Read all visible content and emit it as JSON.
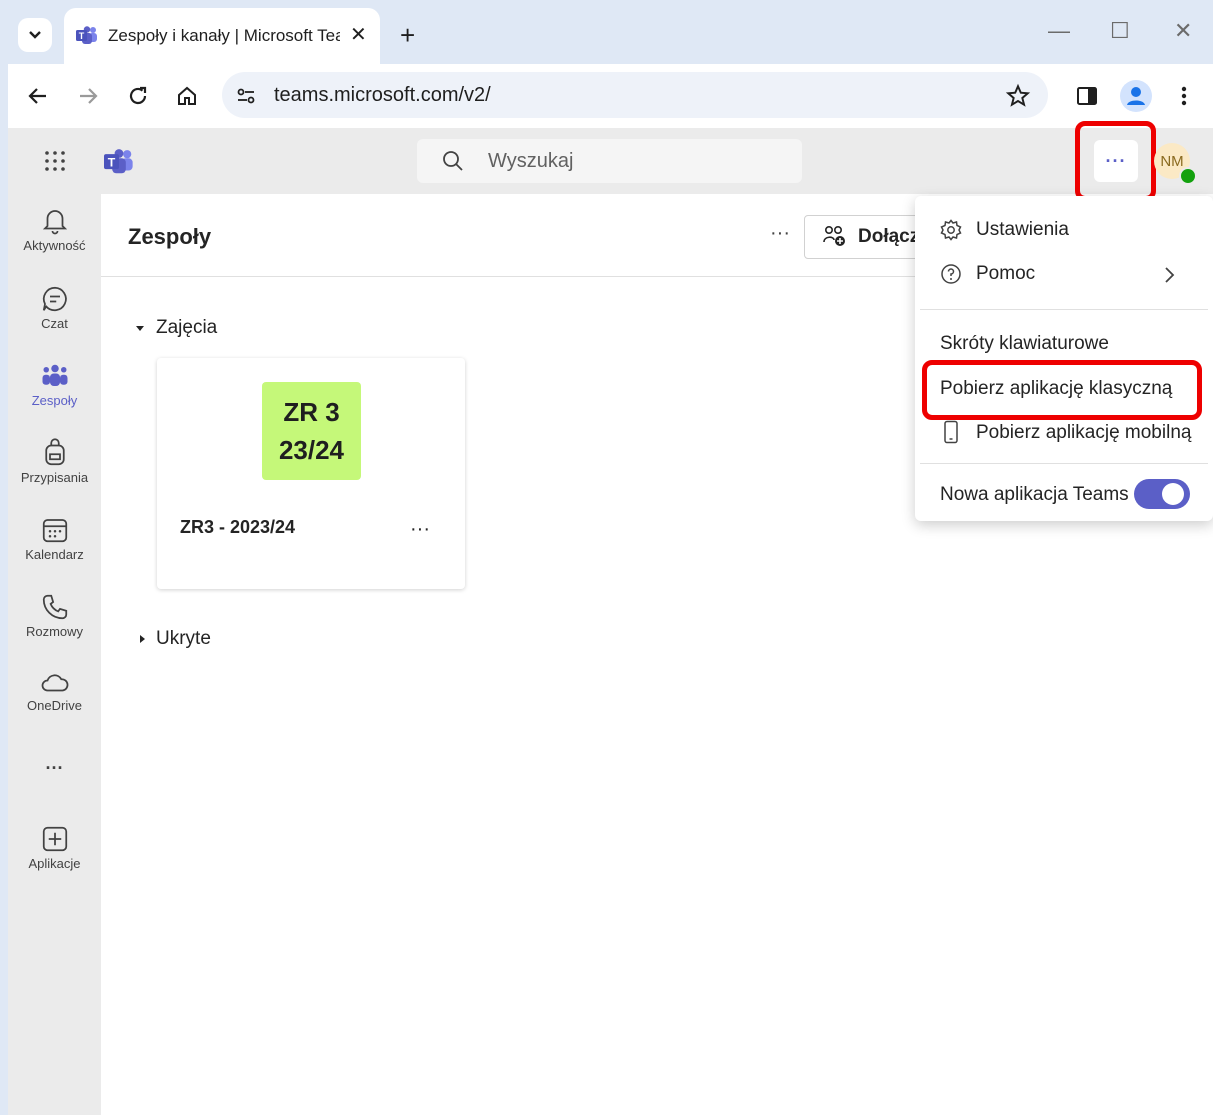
{
  "browser": {
    "tab_title": "Zespoły i kanały | Microsoft Teams",
    "tab_close": "✕",
    "new_tab": "+",
    "url": "teams.microsoft.com/v2/",
    "window_controls": {
      "minimize": "—",
      "maximize": "☐",
      "close": "✕"
    }
  },
  "teams_header": {
    "search_placeholder": "Wyszukaj",
    "more_label": "···",
    "avatar_initials": "NM"
  },
  "rail": {
    "items": [
      {
        "label": "Aktywność",
        "icon": "bell-icon"
      },
      {
        "label": "Czat",
        "icon": "chat-icon"
      },
      {
        "label": "Zespoły",
        "icon": "teams-icon",
        "active": true
      },
      {
        "label": "Przypisania",
        "icon": "backpack-icon"
      },
      {
        "label": "Kalendarz",
        "icon": "calendar-icon"
      },
      {
        "label": "Rozmowy",
        "icon": "phone-icon"
      },
      {
        "label": "OneDrive",
        "icon": "cloud-icon"
      },
      {
        "label": "Aplikacje",
        "icon": "add-app-icon"
      }
    ],
    "more": "···"
  },
  "main": {
    "title": "Zespoły",
    "more_label": "···",
    "join_button": "Dołącz",
    "groups": [
      {
        "label": "Zajęcia",
        "expanded": true
      },
      {
        "label": "Ukryte",
        "expanded": false
      }
    ],
    "team_card": {
      "tile_line1": "ZR 3",
      "tile_line2": "23/24",
      "tile_color": "#c5f879",
      "name": "ZR3 - 2023/24",
      "more_label": "···"
    }
  },
  "menu": {
    "settings": "Ustawienia",
    "help": "Pomoc",
    "shortcuts": "Skróty klawiaturowe",
    "desktop_app": "Pobierz aplikację klasyczną",
    "mobile_app": "Pobierz aplikację mobilną",
    "new_teams": "Nowa aplikacja Teams",
    "new_teams_enabled": true
  },
  "colors": {
    "accent": "#5b5fc7",
    "highlight": "#ee0000"
  }
}
